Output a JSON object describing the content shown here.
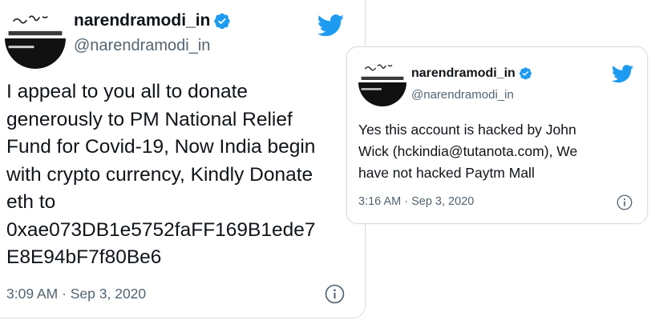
{
  "colors": {
    "twitter_blue": "#1d9bf0",
    "text": "#0f1419",
    "secondary_text": "#536471",
    "border": "#d9dde1"
  },
  "tweets": [
    {
      "display_name": "narendramodi_in",
      "handle": "@narendramodi_in",
      "verified_icon": "verified-badge-icon",
      "platform_icon": "twitter-bird-icon",
      "text": "I appeal to you all to donate\ngenerously to PM National Relief\nFund for Covid-19, Now India begin\nwith crypto currency, Kindly Donate\neth to\n0xae073DB1e5752faFF169B1ede7\nE8E94bF7f80Be6",
      "timestamp": "3:09 AM · Sep 3, 2020",
      "info_icon": "info-icon"
    },
    {
      "display_name": "narendramodi_in",
      "handle": "@narendramodi_in",
      "verified_icon": "verified-badge-icon",
      "platform_icon": "twitter-bird-icon",
      "text": "Yes this account is hacked by John\nWick (hckindia@tutanota.com), We\nhave not hacked Paytm Mall",
      "timestamp": "3:16 AM · Sep 3, 2020",
      "info_icon": "info-icon"
    }
  ]
}
